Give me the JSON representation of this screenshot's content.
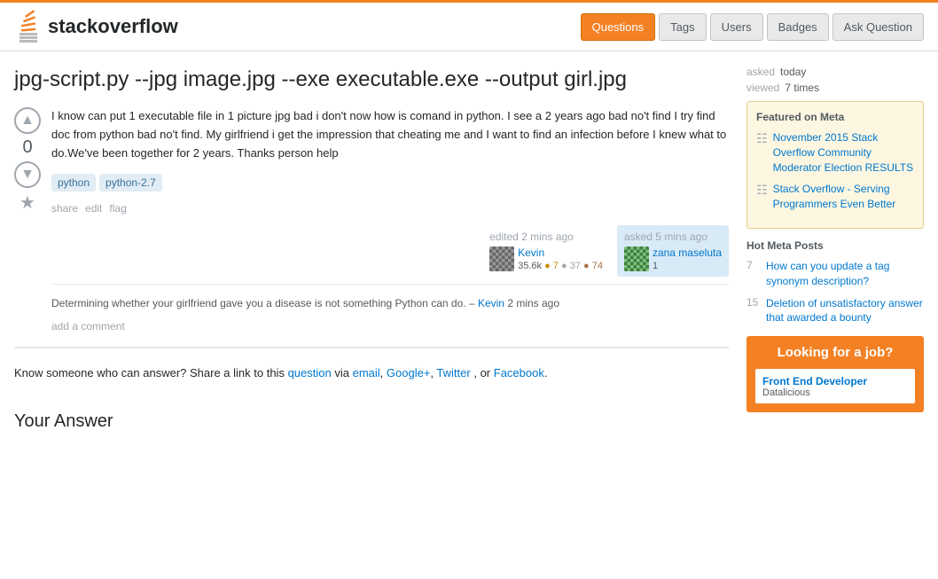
{
  "header": {
    "logo_text_normal": "stack",
    "logo_text_bold": "overflow",
    "nav": [
      {
        "label": "Questions",
        "active": true
      },
      {
        "label": "Tags",
        "active": false
      },
      {
        "label": "Users",
        "active": false
      },
      {
        "label": "Badges",
        "active": false
      },
      {
        "label": "Ask Question",
        "active": false
      }
    ]
  },
  "question": {
    "title": "jpg-script.py --jpg image.jpg --exe executable.exe --output girl.jpg",
    "body": "I know can put 1 executable file in 1 picture jpg bad i don't now how is comand in python. I see a 2 years ago bad no't find I try find doc from python bad no't find. My girlfriend i get the impression that cheating me and I want to find an infection before I knew what to do.We've been together for 2 years. Thanks person help",
    "tags": [
      "python",
      "python-2.7"
    ],
    "actions": [
      "share",
      "edit",
      "flag"
    ],
    "vote_count": "0",
    "editor": {
      "action": "edited 2 mins ago",
      "name": "Kevin",
      "rep": "35.6k",
      "gold": "7",
      "silver": "37",
      "bronze": "74"
    },
    "asker": {
      "action": "asked 5 mins ago",
      "name": "zana maseluta",
      "rep": "1"
    },
    "comment": {
      "text": "Determining whether your girlfriend gave you a disease is not something Python can do.",
      "author": "Kevin",
      "time": "2 mins ago"
    },
    "add_comment_label": "add a comment"
  },
  "know_someone": {
    "text_before": "Know someone who can answer? Share a link to this",
    "question_link": "question",
    "text_via": " via ",
    "email_link": "email",
    "gplus_link": "Google+",
    "twitter_link": "Twitter",
    "text_or": ", or",
    "facebook_link": "Facebook",
    "text_end": "."
  },
  "your_answer_label": "Your Answer",
  "sidebar": {
    "asked_label": "asked",
    "asked_value": "today",
    "viewed_label": "viewed",
    "viewed_value": "7 times",
    "featured_meta_title": "Featured on Meta",
    "featured_meta_items": [
      {
        "link": "November 2015 Stack Overflow Community Moderator Election RESULTS"
      },
      {
        "link": "Stack Overflow - Serving Programmers Even Better"
      }
    ],
    "hot_meta_title": "Hot Meta Posts",
    "hot_meta_items": [
      {
        "num": "7",
        "link": "How can you update a tag synonym description?"
      },
      {
        "num": "15",
        "link": "Deletion of unsatisfactory answer that awarded a bounty"
      }
    ],
    "job_box_title": "Looking for a job?",
    "job_title": "Front End Developer",
    "job_company": "Datalicious"
  }
}
